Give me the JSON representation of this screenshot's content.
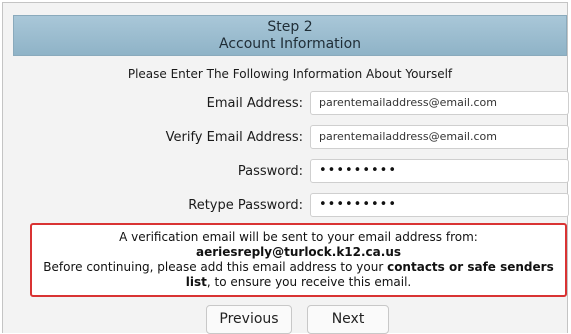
{
  "header": {
    "step": "Step 2",
    "title": "Account Information"
  },
  "intro": "Please Enter The Following Information About Yourself",
  "fields": {
    "email": {
      "label": "Email Address:",
      "value": "parentemailaddress@email.com"
    },
    "verify_email": {
      "label": "Verify Email Address:",
      "value": "parentemailaddress@email.com"
    },
    "password": {
      "label": "Password:",
      "value": "•••••••••"
    },
    "retype_password": {
      "label": "Retype Password:",
      "value": "•••••••••"
    }
  },
  "notice": {
    "line1": "A verification email will be sent to your email address from:",
    "sender": "aeriesreply@turlock.k12.ca.us",
    "line3_pre": "Before continuing, please add this email address to your ",
    "line3_bold": "contacts or safe senders list",
    "line3_post": ", to ensure you receive this email."
  },
  "buttons": {
    "previous": "Previous",
    "next": "Next"
  },
  "colors": {
    "header_bg": "#9dbdd0",
    "notice_border": "#d93333",
    "panel_bg": "#f3f3f3"
  }
}
